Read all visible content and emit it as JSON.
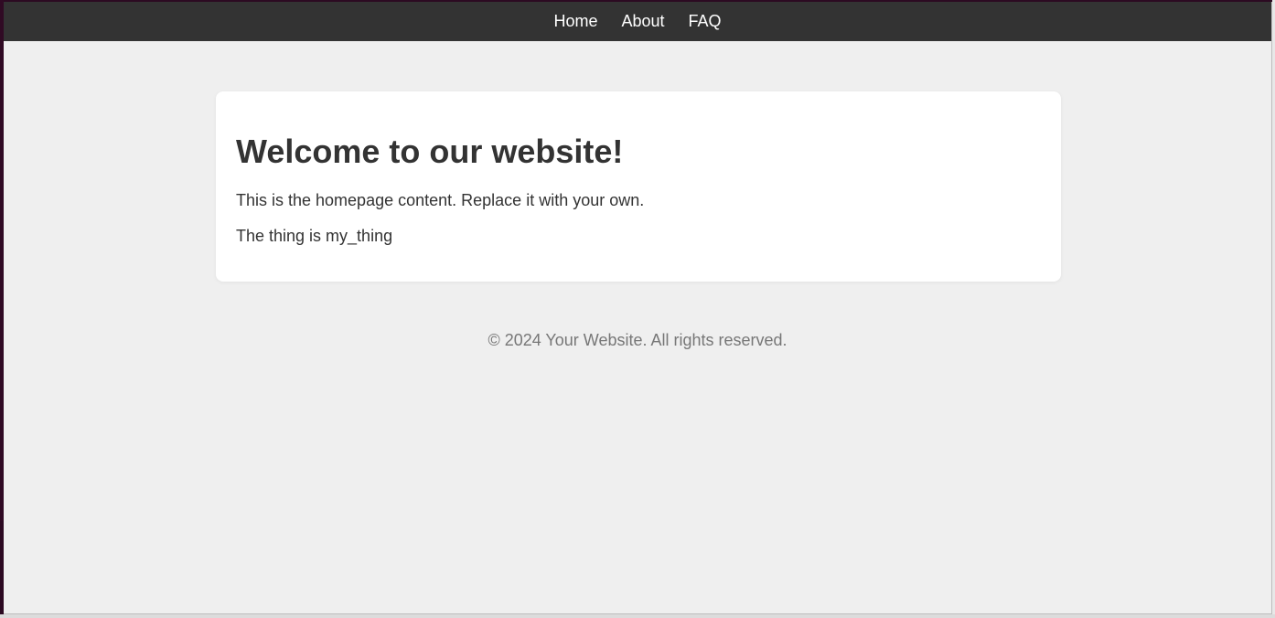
{
  "nav": {
    "items": [
      "Home",
      "About",
      "FAQ"
    ]
  },
  "main": {
    "heading": "Welcome to our website!",
    "intro": "This is the homepage content. Replace it with your own.",
    "thing_line": "The thing is my_thing"
  },
  "footer": {
    "text": "© 2024 Your Website. All rights reserved."
  },
  "colors": {
    "navbar": "#333333",
    "page_background": "#efefef",
    "card_background": "#ffffff",
    "text": "#333333",
    "footer_text": "#777777"
  }
}
